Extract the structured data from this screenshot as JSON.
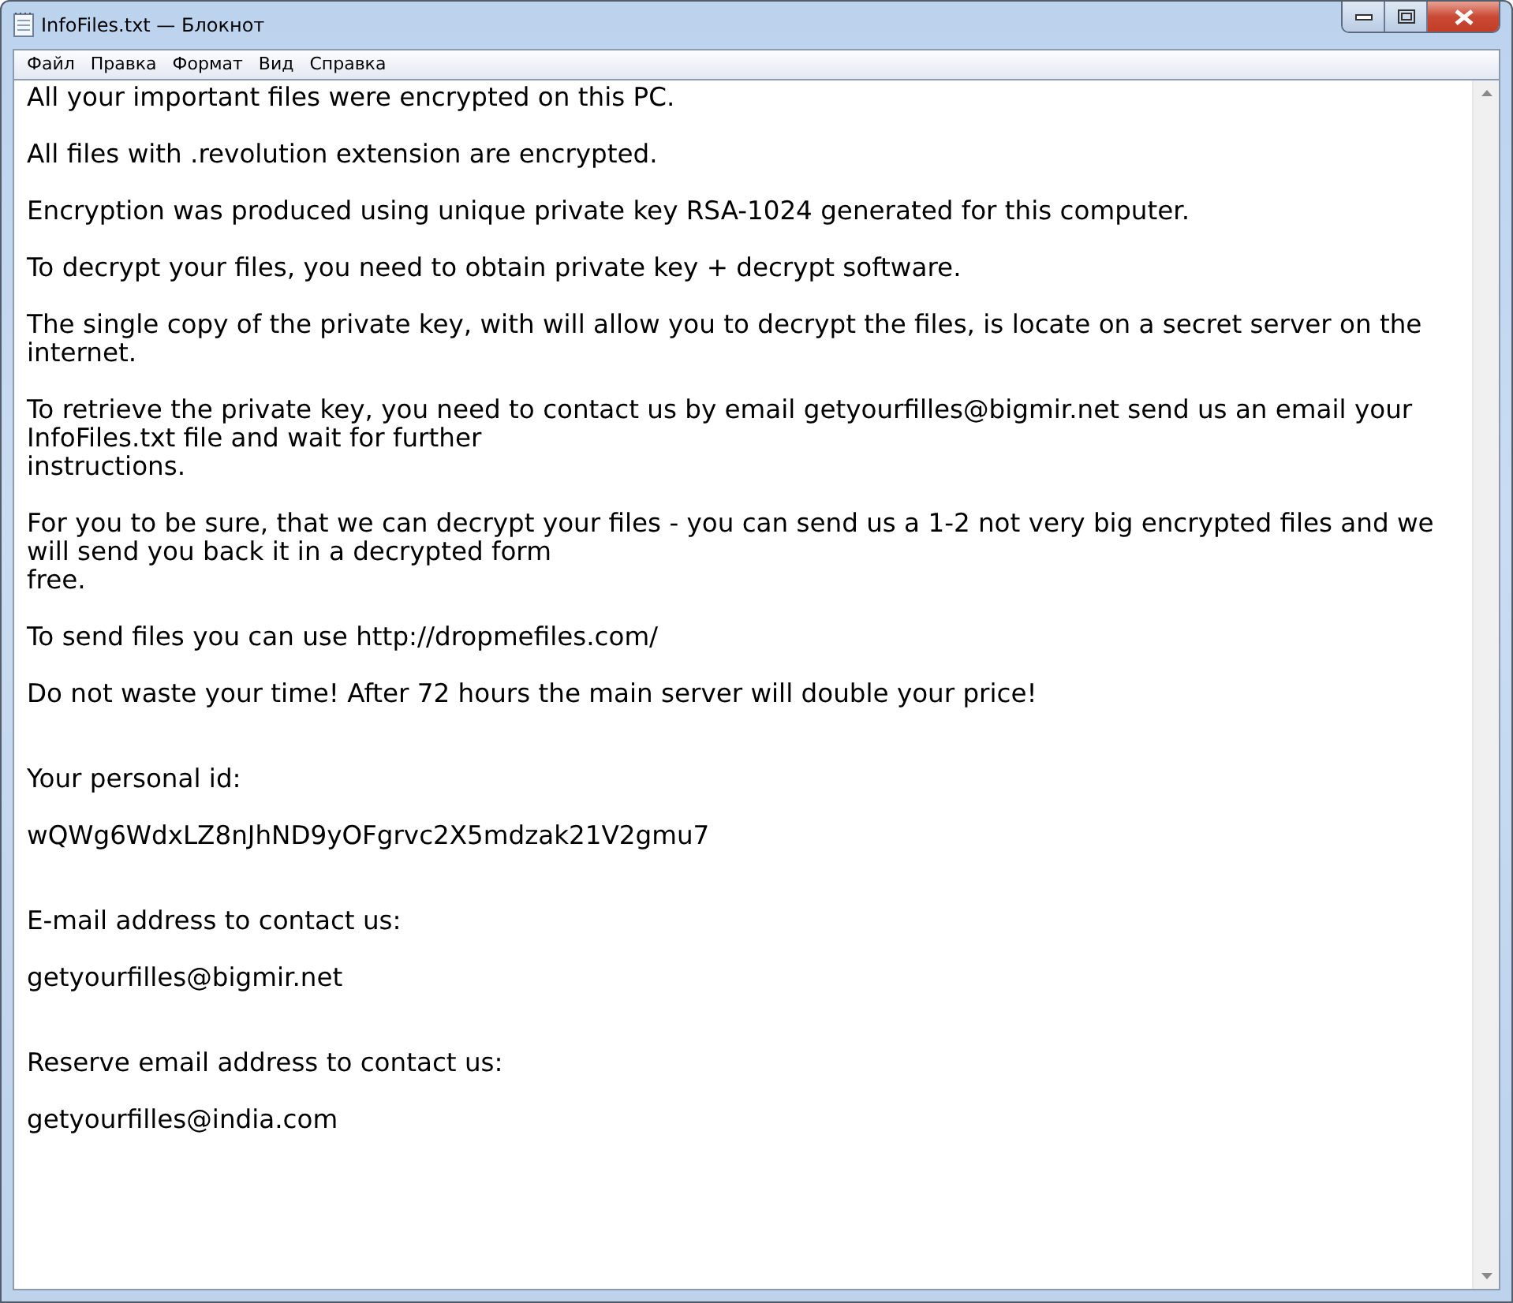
{
  "window": {
    "title": "InfoFiles.txt — Блокнот"
  },
  "menu": [
    "Файл",
    "Правка",
    "Формат",
    "Вид",
    "Справка"
  ],
  "document": {
    "paragraphs": [
      {
        "kind": "paragraph",
        "lines": [
          "All your important files were encrypted on this PC."
        ]
      },
      {
        "kind": "paragraph",
        "lines": [
          "All files with .revolution extension are encrypted."
        ]
      },
      {
        "kind": "paragraph",
        "lines": [
          "Encryption was produced using unique private key RSA-1024 generated for this computer."
        ]
      },
      {
        "kind": "paragraph",
        "lines": [
          "To decrypt your files, you need to obtain private key + decrypt software."
        ]
      },
      {
        "kind": "paragraph",
        "lines": [
          "The single copy of the private key, with will allow you to decrypt the files, is locate on a secret server on the",
          "internet."
        ]
      },
      {
        "kind": "paragraph",
        "lines": [
          "To retrieve the private key, you need to contact us by email getyourfilles@bigmir.net send us an email your",
          "InfoFiles.txt file and wait for further",
          "instructions."
        ]
      },
      {
        "kind": "paragraph",
        "lines": [
          "For you to be sure, that we can decrypt your files - you can send us a 1-2 not very big encrypted files and we",
          "will send you back it in a decrypted form",
          "free."
        ]
      },
      {
        "kind": "paragraph",
        "lines": [
          "To send files you can use http://dropmefiles.com/"
        ]
      },
      {
        "kind": "paragraph",
        "lines": [
          "Do not waste your time! After 72 hours the main server will double your price!"
        ]
      },
      {
        "kind": "section",
        "lines": [
          "Your personal id:"
        ]
      },
      {
        "kind": "paragraph",
        "lines": [
          "wQWg6WdxLZ8nJhND9yOFgrvc2X5mdzak21V2gmu7"
        ]
      },
      {
        "kind": "section",
        "lines": [
          "E-mail address to contact us:"
        ]
      },
      {
        "kind": "paragraph",
        "lines": [
          "getyourfilles@bigmir.net"
        ]
      },
      {
        "kind": "section",
        "lines": [
          "Reserve email address to contact us:"
        ]
      },
      {
        "kind": "paragraph",
        "lines": [
          "getyourfilles@india.com"
        ]
      }
    ]
  }
}
